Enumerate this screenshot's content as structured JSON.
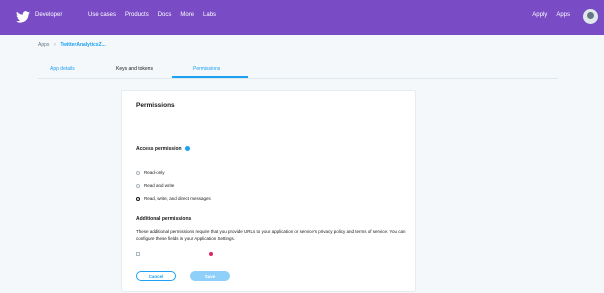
{
  "nav": {
    "brand": "Developer",
    "links": [
      "Use cases",
      "Products",
      "Docs",
      "More",
      "Labs"
    ],
    "right_links": [
      "Apply",
      "Apps"
    ]
  },
  "breadcrumb": {
    "root": "Apps",
    "separator": ">",
    "current": "TwitterAnalyticsZ..."
  },
  "tabs": [
    "App details",
    "Keys and tokens",
    "Permissions"
  ],
  "card": {
    "title": "Permissions",
    "access_title": "Access permission",
    "access_options": [
      "Read-only",
      "Read and write",
      "Read, write, and direct messages"
    ],
    "selected_access": "Read, write, and direct messages",
    "additional_title": "Additional permissions",
    "additional_text": "These additional permissions require that you provide URLs to your application or service's privacy policy and terms of service. You can configure these fields in your Application Settings.",
    "cancel_label": "Cancel",
    "save_label": "Save"
  },
  "colors": {
    "nav_bg": "#794bc4",
    "accent": "#1da1f2",
    "required": "#e0245e"
  }
}
